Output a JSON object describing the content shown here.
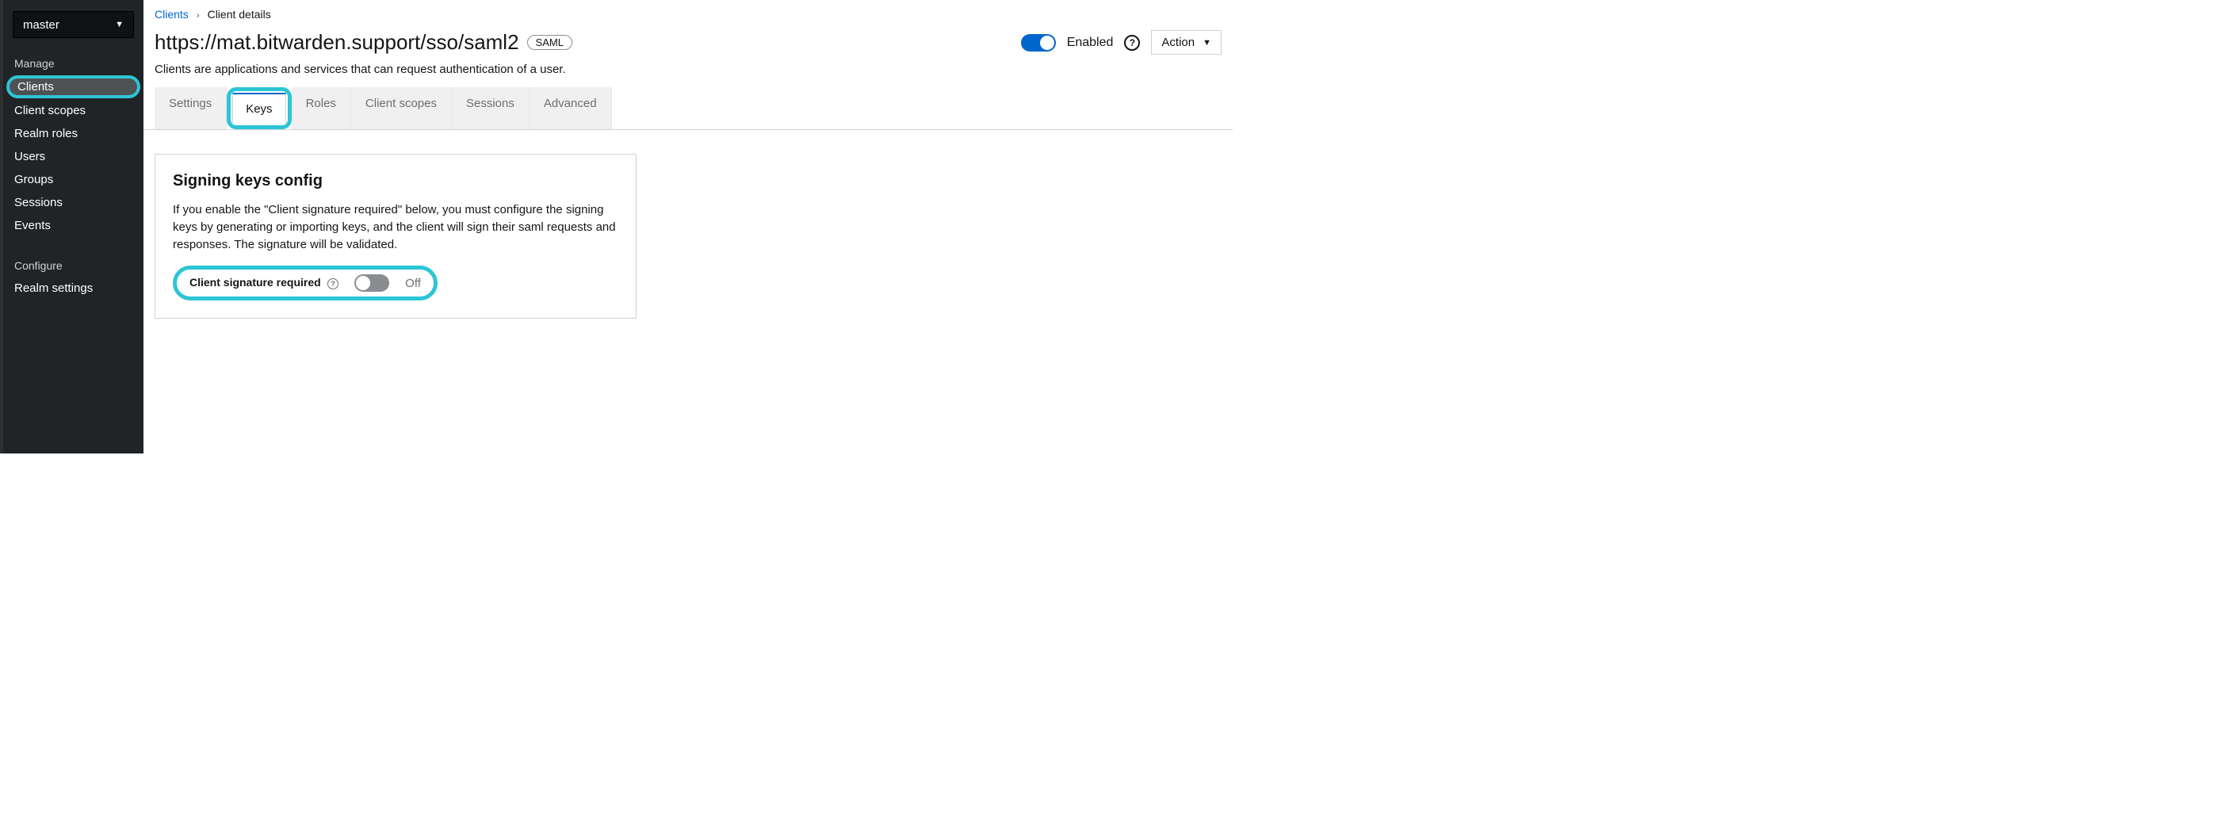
{
  "realm": {
    "selected": "master"
  },
  "sidebar": {
    "sections": {
      "manage": {
        "label": "Manage",
        "items": [
          {
            "label": "Clients",
            "active": true
          },
          {
            "label": "Client scopes"
          },
          {
            "label": "Realm roles"
          },
          {
            "label": "Users"
          },
          {
            "label": "Groups"
          },
          {
            "label": "Sessions"
          },
          {
            "label": "Events"
          }
        ]
      },
      "configure": {
        "label": "Configure",
        "items": [
          {
            "label": "Realm settings"
          }
        ]
      }
    }
  },
  "breadcrumb": {
    "parent": "Clients",
    "current": "Client details"
  },
  "header": {
    "title": "https://mat.bitwarden.support/sso/saml2",
    "protocol_badge": "SAML",
    "description": "Clients are applications and services that can request authentication of a user.",
    "enabled_label": "Enabled",
    "action_label": "Action"
  },
  "tabs": [
    {
      "label": "Settings"
    },
    {
      "label": "Keys",
      "active": true
    },
    {
      "label": "Roles"
    },
    {
      "label": "Client scopes"
    },
    {
      "label": "Sessions"
    },
    {
      "label": "Advanced"
    }
  ],
  "panel": {
    "heading": "Signing keys config",
    "description": "If you enable the \"Client signature required\" below, you must configure the signing keys by generating or importing keys, and the client will sign their saml requests and responses. The signature will be validated.",
    "client_sig_label": "Client signature required",
    "client_sig_state": "Off"
  }
}
